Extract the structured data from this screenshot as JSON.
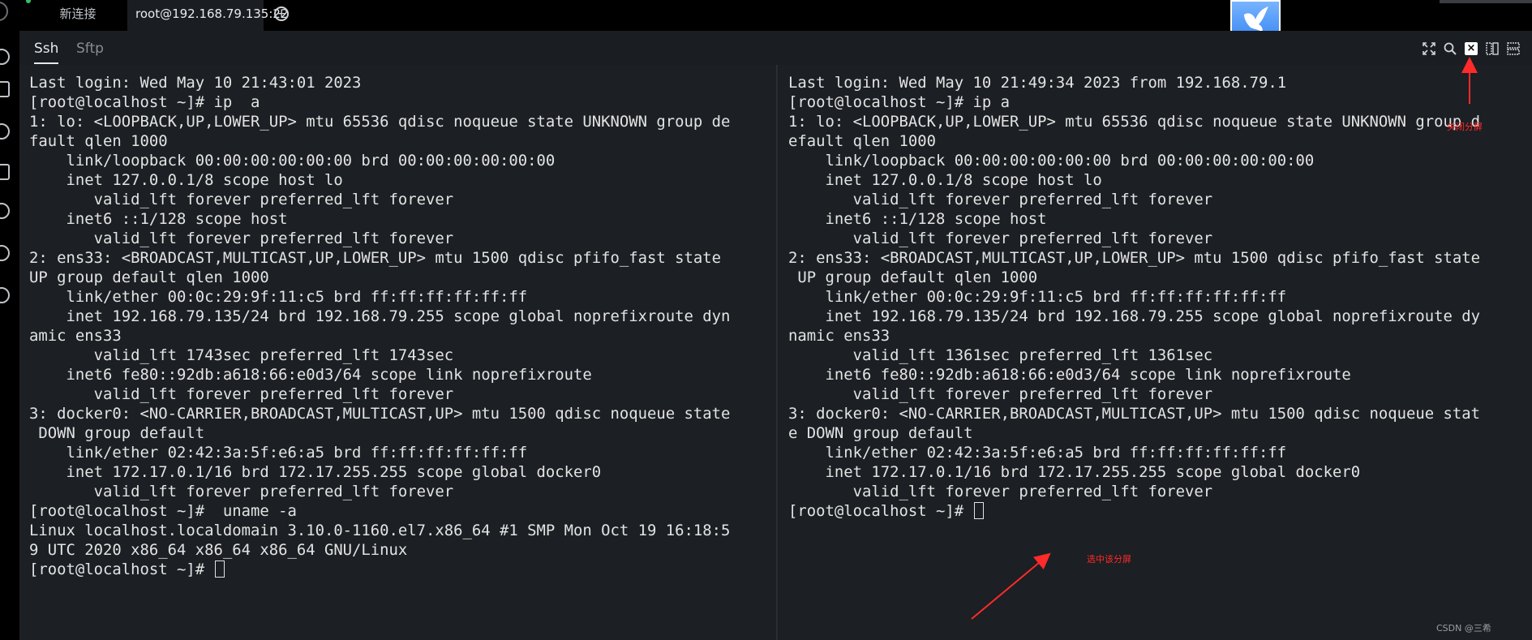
{
  "window": {
    "tabs": [
      {
        "label": "新连接",
        "active": false
      },
      {
        "label": "root@192.168.79.135:22",
        "active": true
      }
    ],
    "add_tab_glyph": "+"
  },
  "session_tabs": [
    {
      "label": "Ssh",
      "active": true
    },
    {
      "label": "Sftp",
      "active": false
    }
  ],
  "toolbar": {
    "icons": [
      "fullscreen-icon",
      "search-icon",
      "close-split-icon",
      "split-vertical-icon",
      "split-grid-icon"
    ],
    "close_glyph": "×"
  },
  "left_pane": {
    "lines": [
      "Last login: Wed May 10 21:43:01 2023",
      "[root@localhost ~]# ip  a",
      "1: lo: <LOOPBACK,UP,LOWER_UP> mtu 65536 qdisc noqueue state UNKNOWN group de",
      "fault qlen 1000",
      "    link/loopback 00:00:00:00:00:00 brd 00:00:00:00:00:00",
      "    inet 127.0.0.1/8 scope host lo",
      "       valid_lft forever preferred_lft forever",
      "    inet6 ::1/128 scope host",
      "       valid_lft forever preferred_lft forever",
      "2: ens33: <BROADCAST,MULTICAST,UP,LOWER_UP> mtu 1500 qdisc pfifo_fast state",
      "UP group default qlen 1000",
      "    link/ether 00:0c:29:9f:11:c5 brd ff:ff:ff:ff:ff:ff",
      "    inet 192.168.79.135/24 brd 192.168.79.255 scope global noprefixroute dyn",
      "amic ens33",
      "       valid_lft 1743sec preferred_lft 1743sec",
      "    inet6 fe80::92db:a618:66:e0d3/64 scope link noprefixroute",
      "       valid_lft forever preferred_lft forever",
      "3: docker0: <NO-CARRIER,BROADCAST,MULTICAST,UP> mtu 1500 qdisc noqueue state",
      " DOWN group default",
      "    link/ether 02:42:3a:5f:e6:a5 brd ff:ff:ff:ff:ff:ff",
      "    inet 172.17.0.1/16 brd 172.17.255.255 scope global docker0",
      "       valid_lft forever preferred_lft forever",
      "[root@localhost ~]#  uname -a",
      "Linux localhost.localdomain 3.10.0-1160.el7.x86_64 #1 SMP Mon Oct 19 16:18:5",
      "9 UTC 2020 x86_64 x86_64 x86_64 GNU/Linux"
    ],
    "prompt": "[root@localhost ~]# "
  },
  "right_pane": {
    "lines": [
      "Last login: Wed May 10 21:49:34 2023 from 192.168.79.1",
      "[root@localhost ~]# ip a",
      "1: lo: <LOOPBACK,UP,LOWER_UP> mtu 65536 qdisc noqueue state UNKNOWN group d",
      "efault qlen 1000",
      "    link/loopback 00:00:00:00:00:00 brd 00:00:00:00:00:00",
      "    inet 127.0.0.1/8 scope host lo",
      "       valid_lft forever preferred_lft forever",
      "    inet6 ::1/128 scope host",
      "       valid_lft forever preferred_lft forever",
      "2: ens33: <BROADCAST,MULTICAST,UP,LOWER_UP> mtu 1500 qdisc pfifo_fast state",
      " UP group default qlen 1000",
      "    link/ether 00:0c:29:9f:11:c5 brd ff:ff:ff:ff:ff:ff",
      "    inet 192.168.79.135/24 brd 192.168.79.255 scope global noprefixroute dy",
      "namic ens33",
      "       valid_lft 1361sec preferred_lft 1361sec",
      "    inet6 fe80::92db:a618:66:e0d3/64 scope link noprefixroute",
      "       valid_lft forever preferred_lft forever",
      "3: docker0: <NO-CARRIER,BROADCAST,MULTICAST,UP> mtu 1500 qdisc noqueue stat",
      "e DOWN group default",
      "    link/ether 02:42:3a:5f:e6:a5 brd ff:ff:ff:ff:ff:ff",
      "    inet 172.17.0.1/16 brd 172.17.255.255 scope global docker0",
      "       valid_lft forever preferred_lft forever"
    ],
    "prompt": "[root@localhost ~]# "
  },
  "annotations": {
    "close_split_label": "关闭分屏",
    "select_pane_label": "选中该分屏",
    "color": "#ff2a2a"
  },
  "credit": "CSDN @三希",
  "colors": {
    "background": "#1a1d21",
    "terminal_text": "#e3e3e3",
    "tab_bar": "#000000",
    "status_dot": "#37c060"
  }
}
